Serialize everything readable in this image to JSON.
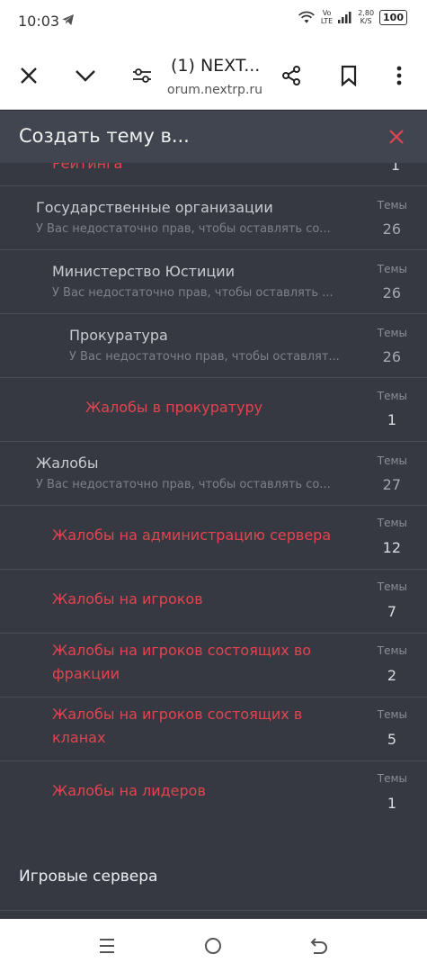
{
  "status": {
    "time": "10:03",
    "network_line1": "Vo",
    "network_line2": "LTE",
    "speed_line1": "2,80",
    "speed_line2": "K/S",
    "battery": "100"
  },
  "toolbar": {
    "tab_title": "(1) NEXT...",
    "url": "orum.nextrp.ru",
    "icons": [
      "close-icon",
      "chevron-down-icon",
      "tune-icon",
      "share-icon",
      "bookmark-icon",
      "more-vert-icon"
    ]
  },
  "modal": {
    "title": "Создать тему в...",
    "close_color": "#e2444f"
  },
  "forums": [
    {
      "title": "Рейтинга",
      "desc": "",
      "stat_label": "",
      "count": "1",
      "red": true
    },
    {
      "title": "Государственные организации",
      "desc": "У Вас недостаточно прав, чтобы оставлять со...",
      "stat_label": "Темы",
      "count": "26",
      "red": false
    },
    {
      "title": "Министерство Юстиции",
      "desc": "У Вас недостаточно прав, чтобы оставлять ...",
      "stat_label": "Темы",
      "count": "26",
      "red": false
    },
    {
      "title": "Прокуратура",
      "desc": "У Вас недостаточно прав, чтобы оставлят...",
      "stat_label": "Темы",
      "count": "26",
      "red": false
    },
    {
      "title": "Жалобы в прокуратуру",
      "desc": "",
      "stat_label": "Темы",
      "count": "1",
      "red": true
    },
    {
      "title": "Жалобы",
      "desc": "У Вас недостаточно прав, чтобы оставлять со...",
      "stat_label": "Темы",
      "count": "27",
      "red": false
    },
    {
      "title": "Жалобы на администрацию сервера",
      "desc": "",
      "stat_label": "Темы",
      "count": "12",
      "red": true
    },
    {
      "title": "Жалобы на игроков",
      "desc": "",
      "stat_label": "Темы",
      "count": "7",
      "red": true
    },
    {
      "title": "Жалобы на игроков состоящих во фракции",
      "desc": "",
      "stat_label": "Темы",
      "count": "2",
      "red": true
    },
    {
      "title": "Жалобы на игроков состоящих в кланах",
      "desc": "",
      "stat_label": "Темы",
      "count": "5",
      "red": true
    },
    {
      "title": "Жалобы на лидеров",
      "desc": "",
      "stat_label": "Темы",
      "count": "1",
      "red": true
    }
  ],
  "section": {
    "title": "Игровые сервера"
  },
  "colors": {
    "accent_red": "#e2444f",
    "list_bg": "#363942",
    "header_bg": "#414550"
  }
}
